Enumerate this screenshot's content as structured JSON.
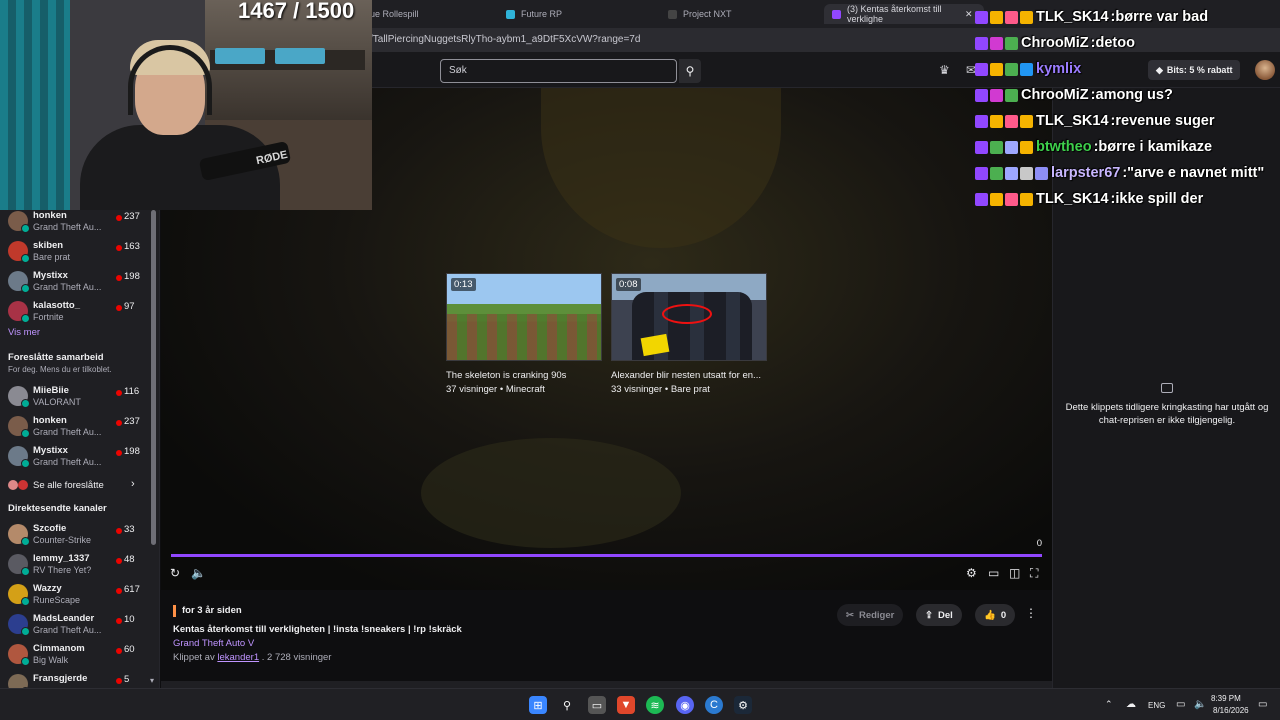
{
  "browser": {
    "tabs": [
      {
        "label": "ue Rollespill"
      },
      {
        "label": "Future RP"
      },
      {
        "label": "Project NXT"
      },
      {
        "label": "(3) Kentas återkomst till verklighe"
      }
    ],
    "url": "/TallPiercingNuggetsRlyTho-aybm1_a9DtF5XcVW?range=7d"
  },
  "stream_overlay": {
    "sub_goal": "1467 / 1500",
    "mic_brand": "RØDE"
  },
  "topnav": {
    "search_placeholder": "Søk",
    "bits_label": "Bits: 5 % rabatt"
  },
  "sidebar": {
    "top_channels": [
      {
        "name": "honken",
        "game": "Grand Theft Au...",
        "viewers": "237",
        "color": "#7a5c4a"
      },
      {
        "name": "skiben",
        "game": "Bare prat",
        "viewers": "163",
        "color": "#c0392b"
      },
      {
        "name": "Mystixx",
        "game": "Grand Theft Au...",
        "viewers": "198",
        "color": "#6c7a89"
      },
      {
        "name": "kalasotto_",
        "game": "Fortnite",
        "viewers": "97",
        "color": "#a83246"
      }
    ],
    "see_more": "Vis mer",
    "suggested_heading": "Foreslåtte samarbeid",
    "suggested_sub": "For deg. Mens du er tilkoblet.",
    "suggested": [
      {
        "name": "MiieBiie",
        "game": "VALORANT",
        "viewers": "116",
        "color": "#8a8a92"
      },
      {
        "name": "honken",
        "game": "Grand Theft Au...",
        "viewers": "237",
        "color": "#7a5c4a"
      },
      {
        "name": "Mystixx",
        "game": "Grand Theft Au...",
        "viewers": "198",
        "color": "#6c7a89"
      }
    ],
    "see_all_suggested": "Se alle foreslåtte",
    "live_heading": "Direktesendte kanaler",
    "live": [
      {
        "name": "Szcofie",
        "game": "Counter-Strike",
        "viewers": "33",
        "color": "#b48a6a"
      },
      {
        "name": "lemmy_1337",
        "game": "RV There Yet?",
        "viewers": "48",
        "color": "#5a5a62"
      },
      {
        "name": "Wazzy",
        "game": "RuneScape",
        "viewers": "617",
        "color": "#d4a017"
      },
      {
        "name": "MadsLeander",
        "game": "Grand Theft Au...",
        "viewers": "10",
        "color": "#2c3e8f"
      },
      {
        "name": "Cimmanom",
        "game": "Big Walk",
        "viewers": "60",
        "color": "#b0573f"
      },
      {
        "name": "Fransgjerde",
        "game": "",
        "viewers": "5",
        "color": "#7d6a55"
      }
    ]
  },
  "player": {
    "recommendations": [
      {
        "duration": "0:13",
        "title": "The skeleton is cranking 90s",
        "meta": "37 visninger • Minecraft"
      },
      {
        "duration": "0:08",
        "title": "Alexander blir nesten utsatt for en...",
        "meta": "33 visninger • Bare prat"
      }
    ],
    "end_count": "0"
  },
  "clip": {
    "time_ago": "for 3 år siden",
    "title": "Kentas återkomst till verkligheten | !insta !sneakers | !rp !skräck",
    "game": "Grand Theft Auto V",
    "clipped_by_prefix": "Klippet av",
    "clipper": "lekander1",
    "views": ". 2 728 visninger",
    "edit_label": "Rediger",
    "share_label": "Del",
    "like_count": "0"
  },
  "chat_panel": {
    "unavailable": "Dette klippets tidligere kringkasting har utgått og chat-reprisen er ikke tilgjengelig."
  },
  "chat_overlay": [
    {
      "name": "TLK_SK14",
      "text": "børre var bad",
      "color": "#ffffff"
    },
    {
      "name": "ChrooMiZ",
      "text": "detoo",
      "color": "#ffffff"
    },
    {
      "name": "kymlix",
      "text": "",
      "color": "#9b7cff"
    },
    {
      "name": "ChrooMiZ",
      "text": "among us?",
      "color": "#ffffff"
    },
    {
      "name": "TLK_SK14",
      "text": "revenue suger",
      "color": "#ffffff"
    },
    {
      "name": "btwtheo",
      "text": "børre i kamikaze",
      "color": "#3ecf4c"
    },
    {
      "name": "larpster67",
      "text": "\"arve e navnet mitt\"",
      "color": "#c8b6ff"
    },
    {
      "name": "TLK_SK14",
      "text": "ikke spill der",
      "color": "#ffffff"
    }
  ],
  "taskbar": {
    "lang": "ENG",
    "time": "8:39 PM",
    "date": "8/16/2026"
  },
  "colors": {
    "accent": "#9147ff",
    "link": "#bf94ff",
    "live": "#eb0400"
  }
}
